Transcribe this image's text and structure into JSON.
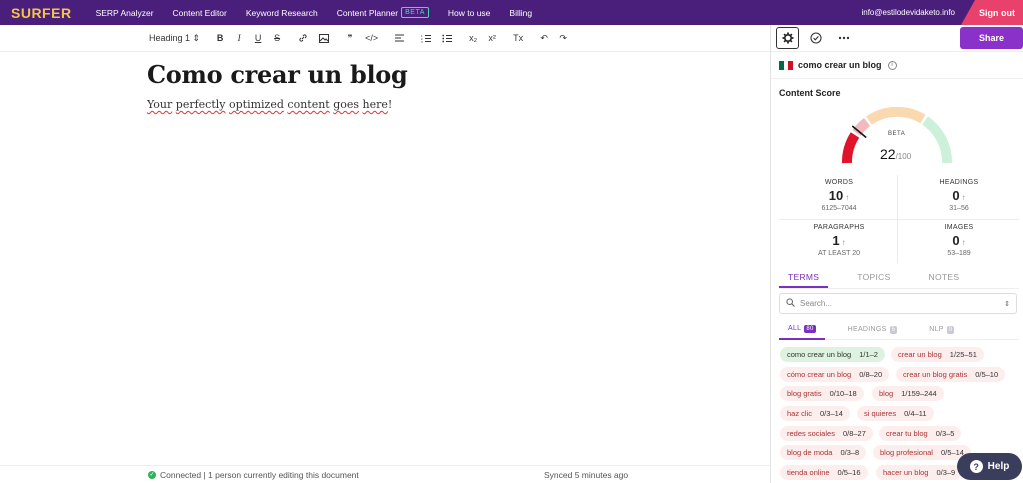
{
  "topbar": {
    "logo": "SURFER",
    "nav": [
      "SERP Analyzer",
      "Content Editor",
      "Keyword Research",
      "Content Planner",
      "How to use",
      "Billing"
    ],
    "beta": "BETA",
    "email": "info@estilodevidaketo.info",
    "signout": "Sign out"
  },
  "toolbar": {
    "heading_select": "Heading 1 ⇕",
    "bold": "B",
    "italic": "I",
    "underline": "U",
    "strike": "S",
    "link": "🔗",
    "image": "▣",
    "quote": "❞",
    "code": "</>",
    "align": "≡",
    "ordered_list": "⒈≡",
    "bullet_list": "•≡",
    "subscript": "x₂",
    "superscript": "x²",
    "clear": "Tx",
    "undo": "↶",
    "redo": "↷"
  },
  "editor": {
    "title": "Como crear un blog",
    "body_words": [
      "Your",
      "perfectly",
      "optimized",
      "content",
      "goes",
      "here"
    ],
    "body_end": "!"
  },
  "status": {
    "connected": "Connected | 1 person currently editing this document",
    "synced": "Synced 5 minutes ago"
  },
  "panel": {
    "share": "Share",
    "keyword": "como crear un blog",
    "flag_colors": [
      "#006847",
      "#ffffff",
      "#ce1126"
    ],
    "content_score_label": "Content Score",
    "score_beta": "BETA",
    "score": "22",
    "score_max": "/100",
    "score_fraction": 0.22,
    "stats": {
      "words": {
        "label": "WORDS",
        "value": "10",
        "range": "6125–7044"
      },
      "headings": {
        "label": "HEADINGS",
        "value": "0",
        "range": "31–56"
      },
      "paragraphs": {
        "label": "PARAGRAPHS",
        "value": "1",
        "range": "AT LEAST 20"
      },
      "images": {
        "label": "IMAGES",
        "value": "0",
        "range": "53–189"
      }
    },
    "arrow": "↑",
    "tabs": [
      "TERMS",
      "TOPICS",
      "NOTES"
    ],
    "search_placeholder": "Search...",
    "filters": [
      {
        "label": "ALL",
        "count": "80"
      },
      {
        "label": "HEADINGS",
        "count": "5"
      },
      {
        "label": "NLP",
        "count": "0"
      }
    ],
    "terms": [
      {
        "text": "como crear un blog",
        "count": "1/1–2",
        "status": "green"
      },
      {
        "text": "crear un blog",
        "count": "1/25–51",
        "status": "red"
      },
      {
        "text": "cómo crear un blog",
        "count": "0/8–20",
        "status": "red"
      },
      {
        "text": "crear un blog gratis",
        "count": "0/5–10",
        "status": "red"
      },
      {
        "text": "blog gratis",
        "count": "0/10–18",
        "status": "red"
      },
      {
        "text": "blog",
        "count": "1/159–244",
        "status": "red"
      },
      {
        "text": "haz clic",
        "count": "0/3–14",
        "status": "red"
      },
      {
        "text": "si quieres",
        "count": "0/4–11",
        "status": "red"
      },
      {
        "text": "redes sociales",
        "count": "0/8–27",
        "status": "red"
      },
      {
        "text": "crear tu blog",
        "count": "0/3–5",
        "status": "red"
      },
      {
        "text": "blog de moda",
        "count": "0/3–8",
        "status": "red"
      },
      {
        "text": "blog profesional",
        "count": "0/5–14",
        "status": "red"
      },
      {
        "text": "tienda online",
        "count": "0/5–16",
        "status": "red"
      },
      {
        "text": "hacer un blog",
        "count": "0/3–9",
        "status": "red"
      }
    ]
  },
  "help": "Help"
}
